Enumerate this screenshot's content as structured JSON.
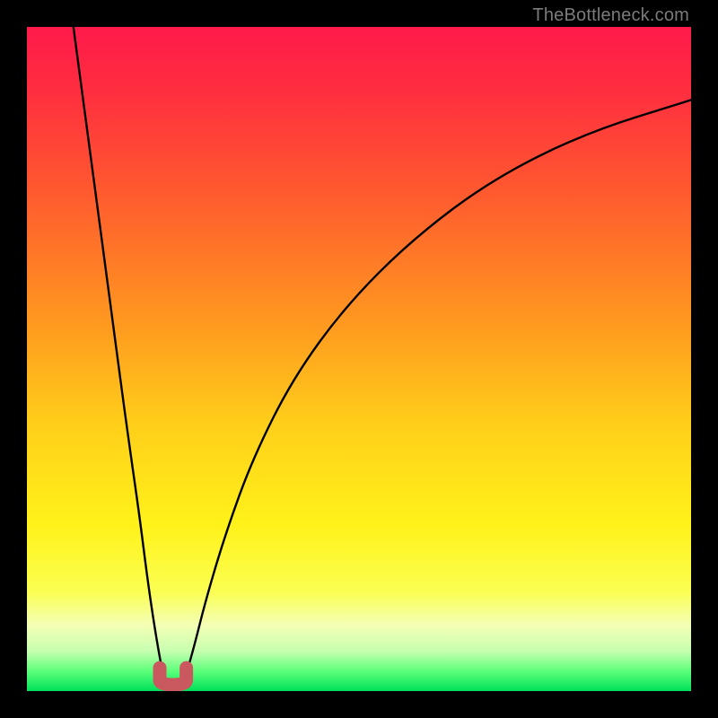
{
  "watermark": "TheBottleneck.com",
  "colors": {
    "frame": "#000000",
    "curve": "#000000",
    "marker": "#c9595e",
    "gradient_stops": [
      {
        "offset": 0.0,
        "color": "#ff1a4b"
      },
      {
        "offset": 0.1,
        "color": "#ff2f3f"
      },
      {
        "offset": 0.25,
        "color": "#ff5a2f"
      },
      {
        "offset": 0.45,
        "color": "#ff9a1f"
      },
      {
        "offset": 0.6,
        "color": "#ffcf1a"
      },
      {
        "offset": 0.75,
        "color": "#fff21a"
      },
      {
        "offset": 0.85,
        "color": "#fbff52"
      },
      {
        "offset": 0.9,
        "color": "#f4ffb5"
      },
      {
        "offset": 0.94,
        "color": "#c7ffb0"
      },
      {
        "offset": 0.97,
        "color": "#5cff7a"
      },
      {
        "offset": 1.0,
        "color": "#00e05a"
      }
    ]
  },
  "chart_data": {
    "type": "line",
    "title": "",
    "xlabel": "",
    "ylabel": "",
    "xlim": [
      0,
      100
    ],
    "ylim": [
      0,
      100
    ],
    "series": [
      {
        "name": "left-branch",
        "x": [
          7,
          9,
          11,
          13,
          15,
          17,
          18,
          19,
          20,
          20.8
        ],
        "values": [
          100,
          85,
          70,
          55,
          40,
          26,
          18,
          11,
          5,
          1
        ]
      },
      {
        "name": "right-branch",
        "x": [
          23.5,
          25,
          27,
          30,
          34,
          40,
          48,
          58,
          70,
          84,
          100
        ],
        "values": [
          1,
          6,
          14,
          24,
          35,
          47,
          58,
          68,
          77,
          84,
          89
        ]
      }
    ],
    "marker": {
      "name": "u-shape",
      "x_range": [
        20.0,
        24.0
      ],
      "y_range": [
        0.0,
        3.5
      ]
    }
  }
}
